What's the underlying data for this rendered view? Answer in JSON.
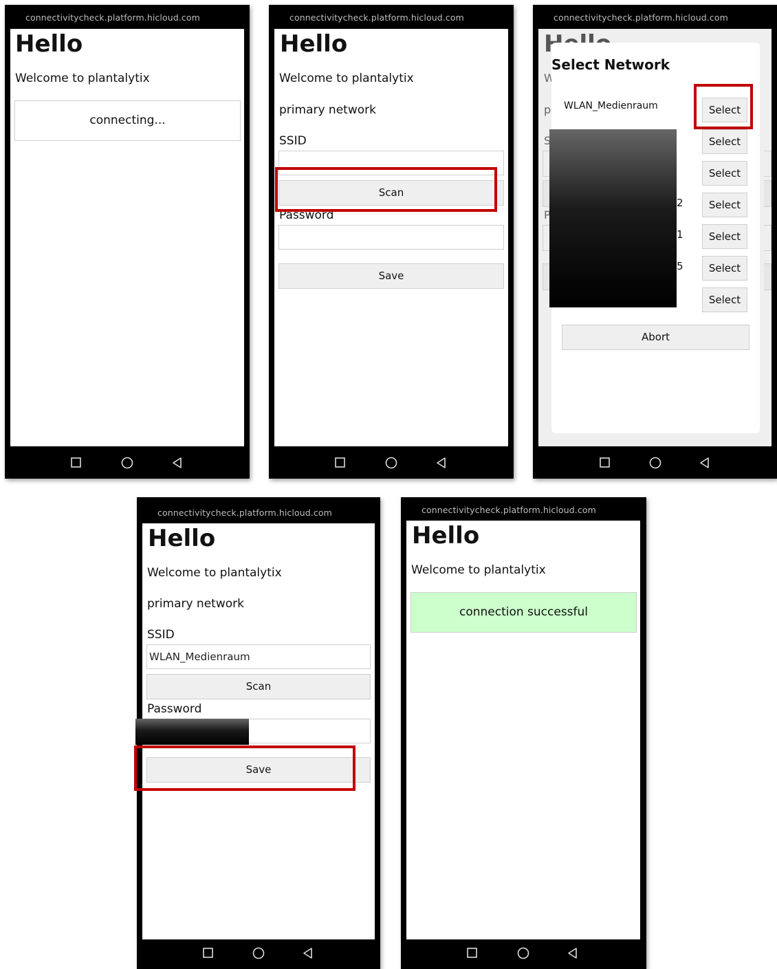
{
  "status_url": "connectivitycheck.platform.hicloud.com",
  "heading": "Hello",
  "welcome": "Welcome to plantalytix",
  "connecting": "connecting...",
  "primary_network": "primary network",
  "ssid_label": "SSID",
  "password_label": "Password",
  "scan_label": "Scan",
  "save_label": "Save",
  "ssid_value": "WLAN_Medienraum",
  "success_message": "connection successful",
  "success_color": "#ccffcc",
  "highlight_color": "#c00000",
  "modal": {
    "title": "Select Network",
    "first_network": "WLAN_Medienraum",
    "select_label": "Select",
    "abort_label": "Abort",
    "partial_digits": [
      "2",
      "1",
      "5"
    ],
    "hidden_heading_fragment": "Hello",
    "left_fragments": [
      "W",
      "p",
      "S",
      "P"
    ]
  },
  "nav_icons": [
    "square-recents-icon",
    "circle-home-icon",
    "triangle-back-icon"
  ]
}
